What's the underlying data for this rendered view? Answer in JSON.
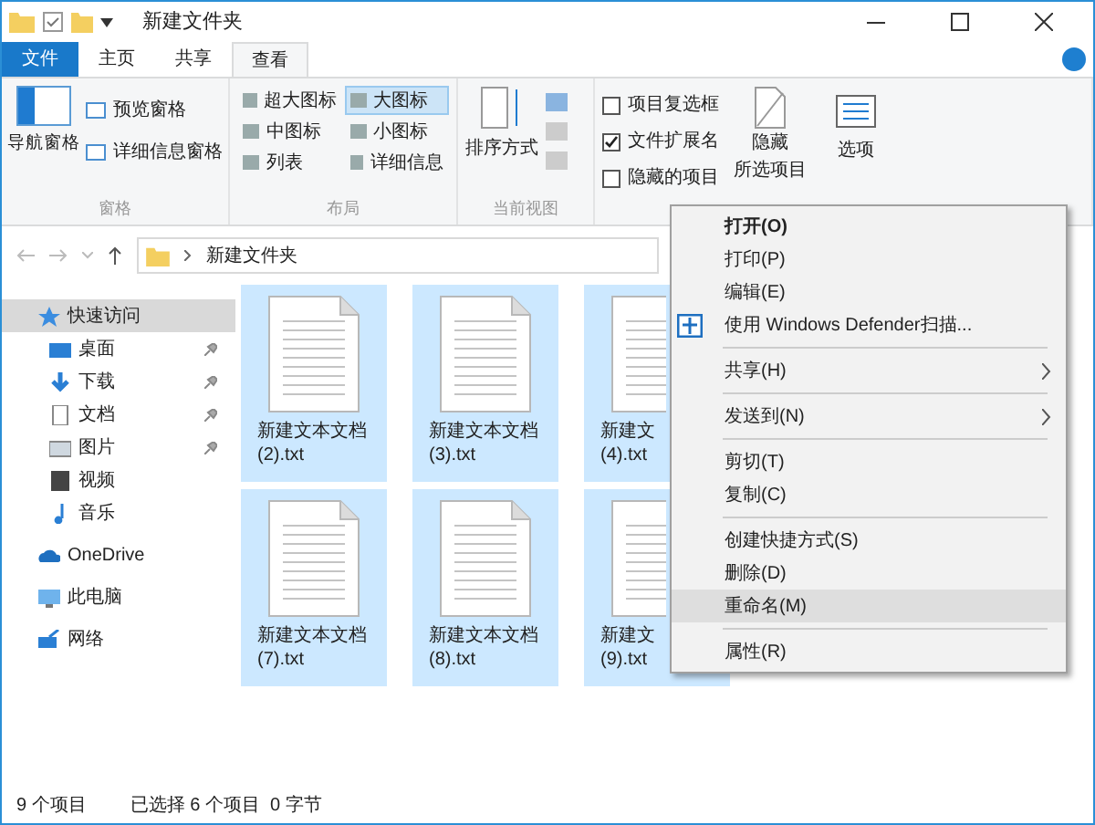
{
  "window": {
    "title": "新建文件夹"
  },
  "tabs": [
    {
      "label": "文件",
      "selected": false,
      "kind": "file"
    },
    {
      "label": "主页",
      "selected": false,
      "kind": "tab"
    },
    {
      "label": "共享",
      "selected": false,
      "kind": "tab"
    },
    {
      "label": "查看",
      "selected": true,
      "kind": "tab"
    }
  ],
  "ribbon": {
    "panes": {
      "big": "导航窗格",
      "items": [
        "预览窗格",
        "详细信息窗格"
      ],
      "group": "窗格"
    },
    "layout": {
      "items": [
        {
          "label": "超大图标",
          "selected": false
        },
        {
          "label": "大图标",
          "selected": true
        },
        {
          "label": "中图标",
          "selected": false
        },
        {
          "label": "小图标",
          "selected": false
        },
        {
          "label": "列表",
          "selected": false
        },
        {
          "label": "详细信息",
          "selected": false
        }
      ],
      "group": "布局"
    },
    "current_view": {
      "big": "排序方式",
      "group": "当前视图"
    },
    "show_hide": {
      "checks": [
        {
          "label": "项目复选框",
          "checked": false
        },
        {
          "label": "文件扩展名",
          "checked": true
        },
        {
          "label": "隐藏的项目",
          "checked": false
        }
      ],
      "hide_button": [
        "隐藏",
        "所选项目"
      ],
      "options": "选项"
    }
  },
  "address": {
    "path": "新建文件夹"
  },
  "sidebar": {
    "items": [
      {
        "label": "快速访问",
        "selected": true,
        "pinned": false
      },
      {
        "label": "桌面",
        "selected": false,
        "pinned": true
      },
      {
        "label": "下载",
        "selected": false,
        "pinned": true
      },
      {
        "label": "文档",
        "selected": false,
        "pinned": true
      },
      {
        "label": "图片",
        "selected": false,
        "pinned": true
      },
      {
        "label": "视频",
        "selected": false,
        "pinned": false
      },
      {
        "label": "音乐",
        "selected": false,
        "pinned": false
      },
      {
        "label": "OneDrive",
        "selected": false,
        "pinned": false
      },
      {
        "label": "此电脑",
        "selected": false,
        "pinned": false
      },
      {
        "label": "网络",
        "selected": false,
        "pinned": false
      }
    ]
  },
  "files": [
    {
      "name": [
        "新建文本文档",
        "(2).txt"
      ],
      "selected": true
    },
    {
      "name": [
        "新建文本文档",
        "(3).txt"
      ],
      "selected": true
    },
    {
      "name": [
        "新建文",
        "(4).txt"
      ],
      "selected": true
    },
    {
      "name": [
        "新建文本文档",
        "(7).txt"
      ],
      "selected": true
    },
    {
      "name": [
        "新建文本文档",
        "(8).txt"
      ],
      "selected": true
    },
    {
      "name": [
        "新建文",
        "(9).txt"
      ],
      "selected": true
    }
  ],
  "context_menu": [
    {
      "kind": "item",
      "label": "打开(O)",
      "default": true,
      "submenu": false,
      "selected": false
    },
    {
      "kind": "item",
      "label": "打印(P)",
      "default": false,
      "submenu": false,
      "selected": false
    },
    {
      "kind": "item",
      "label": "编辑(E)",
      "default": false,
      "submenu": false,
      "selected": false
    },
    {
      "kind": "item",
      "label": "使用 Windows Defender扫描...",
      "default": false,
      "submenu": false,
      "selected": false
    },
    {
      "kind": "separator"
    },
    {
      "kind": "item",
      "label": "共享(H)",
      "default": false,
      "submenu": true,
      "selected": false
    },
    {
      "kind": "separator"
    },
    {
      "kind": "item",
      "label": "发送到(N)",
      "default": false,
      "submenu": true,
      "selected": false
    },
    {
      "kind": "separator"
    },
    {
      "kind": "item",
      "label": "剪切(T)",
      "default": false,
      "submenu": false,
      "selected": false
    },
    {
      "kind": "item",
      "label": "复制(C)",
      "default": false,
      "submenu": false,
      "selected": false
    },
    {
      "kind": "separator"
    },
    {
      "kind": "item",
      "label": "创建快捷方式(S)",
      "default": false,
      "submenu": false,
      "selected": false
    },
    {
      "kind": "item",
      "label": "删除(D)",
      "default": false,
      "submenu": false,
      "selected": false
    },
    {
      "kind": "item",
      "label": "重命名(M)",
      "default": false,
      "submenu": false,
      "selected": true
    },
    {
      "kind": "separator"
    },
    {
      "kind": "item",
      "label": "属性(R)",
      "default": false,
      "submenu": false,
      "selected": false
    }
  ],
  "status_bar": {
    "count": "9 个项目",
    "selection": "已选择 6 个项目  0 字节"
  }
}
